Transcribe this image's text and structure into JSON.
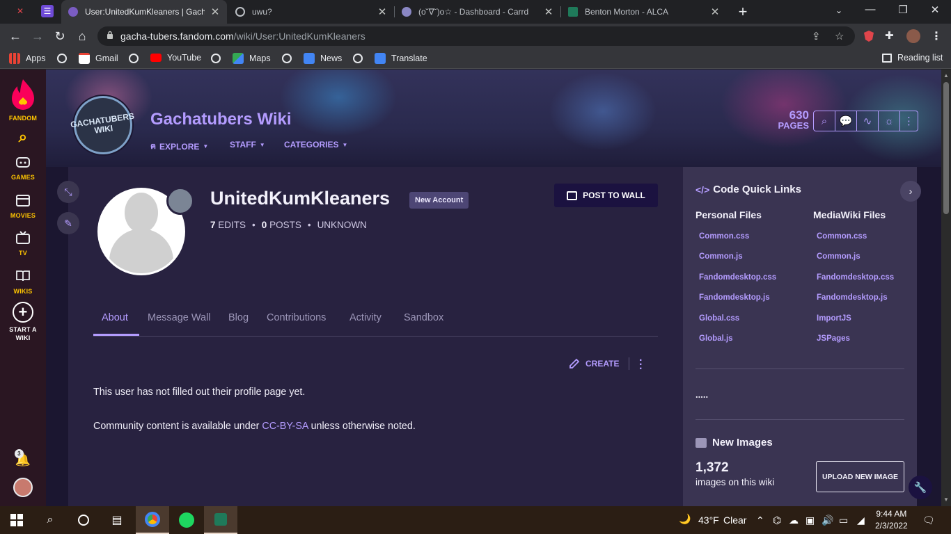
{
  "browser": {
    "tabs": [
      {
        "title": "User:UnitedKumKleaners | Gacha",
        "active": true
      },
      {
        "title": "uwu?",
        "active": false
      },
      {
        "title": "(o˘∇˘)o☆ - Dashboard - Carrd",
        "active": false
      },
      {
        "title": "Benton Morton - ALCA",
        "active": false
      }
    ],
    "url_domain": "gacha-tubers.fandom.com",
    "url_path": "/wiki/User:UnitedKumKleaners",
    "bookmarks": [
      "Apps",
      "Gmail",
      "YouTube",
      "Maps",
      "News",
      "Translate"
    ],
    "reading_list": "Reading list"
  },
  "fandom_rail": {
    "items": [
      {
        "label": "FANDOM"
      },
      {
        "label": "GAMES"
      },
      {
        "label": "MOVIES"
      },
      {
        "label": "TV"
      },
      {
        "label": "WIKIS"
      },
      {
        "label": "START A WIKI"
      }
    ],
    "notification_count": "3"
  },
  "wiki": {
    "logo_text": "GACHATUBERS WIKI",
    "title": "Gachatubers Wiki",
    "nav": [
      "EXPLORE",
      "STAFF",
      "CATEGORIES"
    ],
    "pages_count": "630",
    "pages_label": "PAGES"
  },
  "profile": {
    "username": "UnitedKumKleaners",
    "badge": "New Account",
    "edits_num": "7",
    "edits_label": "EDITS",
    "posts_num": "0",
    "posts_label": "POSTS",
    "status": "UNKNOWN",
    "post_to_wall": "POST TO WALL",
    "tabs": [
      "About",
      "Message Wall",
      "Blog",
      "Contributions",
      "Activity",
      "Sandbox"
    ],
    "create_label": "CREATE",
    "empty_text": "This user has not filled out their profile page yet.",
    "license_prefix": "Community content is available under ",
    "license_link": "CC-BY-SA",
    "license_suffix": " unless otherwise noted."
  },
  "sidebar": {
    "quick_links_title": "Code Quick Links",
    "personal_files_title": "Personal Files",
    "personal_files": [
      "Common.css",
      "Common.js",
      "Fandomdesktop.css",
      "Fandomdesktop.js",
      "Global.css",
      "Global.js"
    ],
    "mediawiki_files_title": "MediaWiki Files",
    "mediawiki_files": [
      "Common.css",
      "Common.js",
      "Fandomdesktop.css",
      "Fandomdesktop.js",
      "ImportJS",
      "JSPages"
    ],
    "dots": ".....",
    "new_images_title": "New Images",
    "images_count": "1,372",
    "images_label": "images on this wiki",
    "upload_label": "UPLOAD NEW IMAGE"
  },
  "taskbar": {
    "temperature": "43°F",
    "weather": "Clear",
    "time": "9:44 AM",
    "date": "2/3/2022"
  }
}
